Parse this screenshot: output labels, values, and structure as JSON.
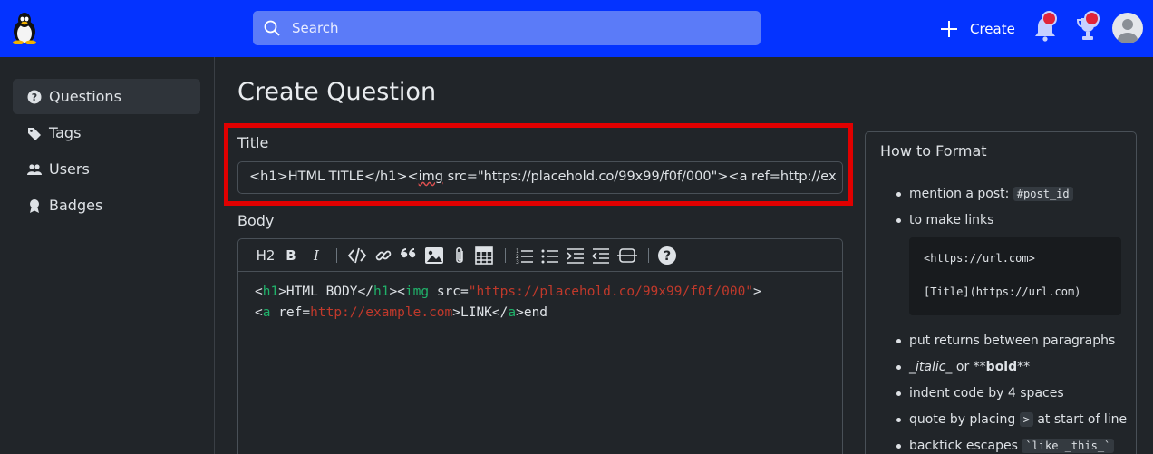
{
  "header": {
    "search_placeholder": "Search",
    "create_label": "Create",
    "brand_color": "#0433ff",
    "icons": [
      "linux-tux-logo",
      "search-icon",
      "plus-icon",
      "bell-icon",
      "trophy-icon",
      "user-avatar-icon"
    ]
  },
  "sidebar": {
    "items": [
      {
        "label": "Questions",
        "icon": "question-circle-icon",
        "active": true
      },
      {
        "label": "Tags",
        "icon": "tags-icon"
      },
      {
        "label": "Users",
        "icon": "users-icon"
      },
      {
        "label": "Badges",
        "icon": "badge-icon"
      }
    ]
  },
  "main": {
    "page_title": "Create Question",
    "title_label": "Title",
    "title_value_before": "<h1>HTML TITLE</h1><",
    "title_value_squiggle": "img",
    "title_value_after": " src=\"https://placehold.co/99x99/f0f/000\"><a ref=http://ex",
    "body_label": "Body",
    "toolbar": {
      "heading": "H2",
      "bold": "B",
      "italic": "I",
      "tools": [
        "code-icon",
        "link-icon",
        "quote-icon",
        "image-icon",
        "attachment-icon",
        "table-icon",
        "ordered-list-icon",
        "unordered-list-icon",
        "indent-icon",
        "outdent-icon",
        "horizontal-rule-icon",
        "help-icon"
      ]
    },
    "body_code": {
      "p1": "<",
      "t1": "h1",
      "p2": ">HTML BODY</",
      "t2": "h1",
      "p3": "><",
      "t3": "img",
      "p4": " src=",
      "s1": "\"https://placehold.co/99x99/f0f/000\"",
      "p5": "><",
      "t4": "a",
      "p6": " ref=",
      "s2": "http://example.com",
      "p7": ">LINK</",
      "t5": "a",
      "p8": ">end"
    }
  },
  "format_panel": {
    "title": "How to Format",
    "mention_text": "mention a post: ",
    "mention_code": "#post_id",
    "links_text": "to make links",
    "link_example_1": "<https://url.com>",
    "link_example_2": "[Title](https://url.com)",
    "returns_text": "put returns between paragraphs",
    "italic_text": "_italic_",
    "or_text": " or **",
    "bold_text": "bold",
    "bold_close": "**",
    "indent_text": "indent code by 4 spaces",
    "quote_text": "quote by placing ",
    "quote_code": ">",
    "quote_after": " at start of line",
    "backtick_text": "backtick escapes ",
    "backtick_code": "`like _this_`"
  }
}
